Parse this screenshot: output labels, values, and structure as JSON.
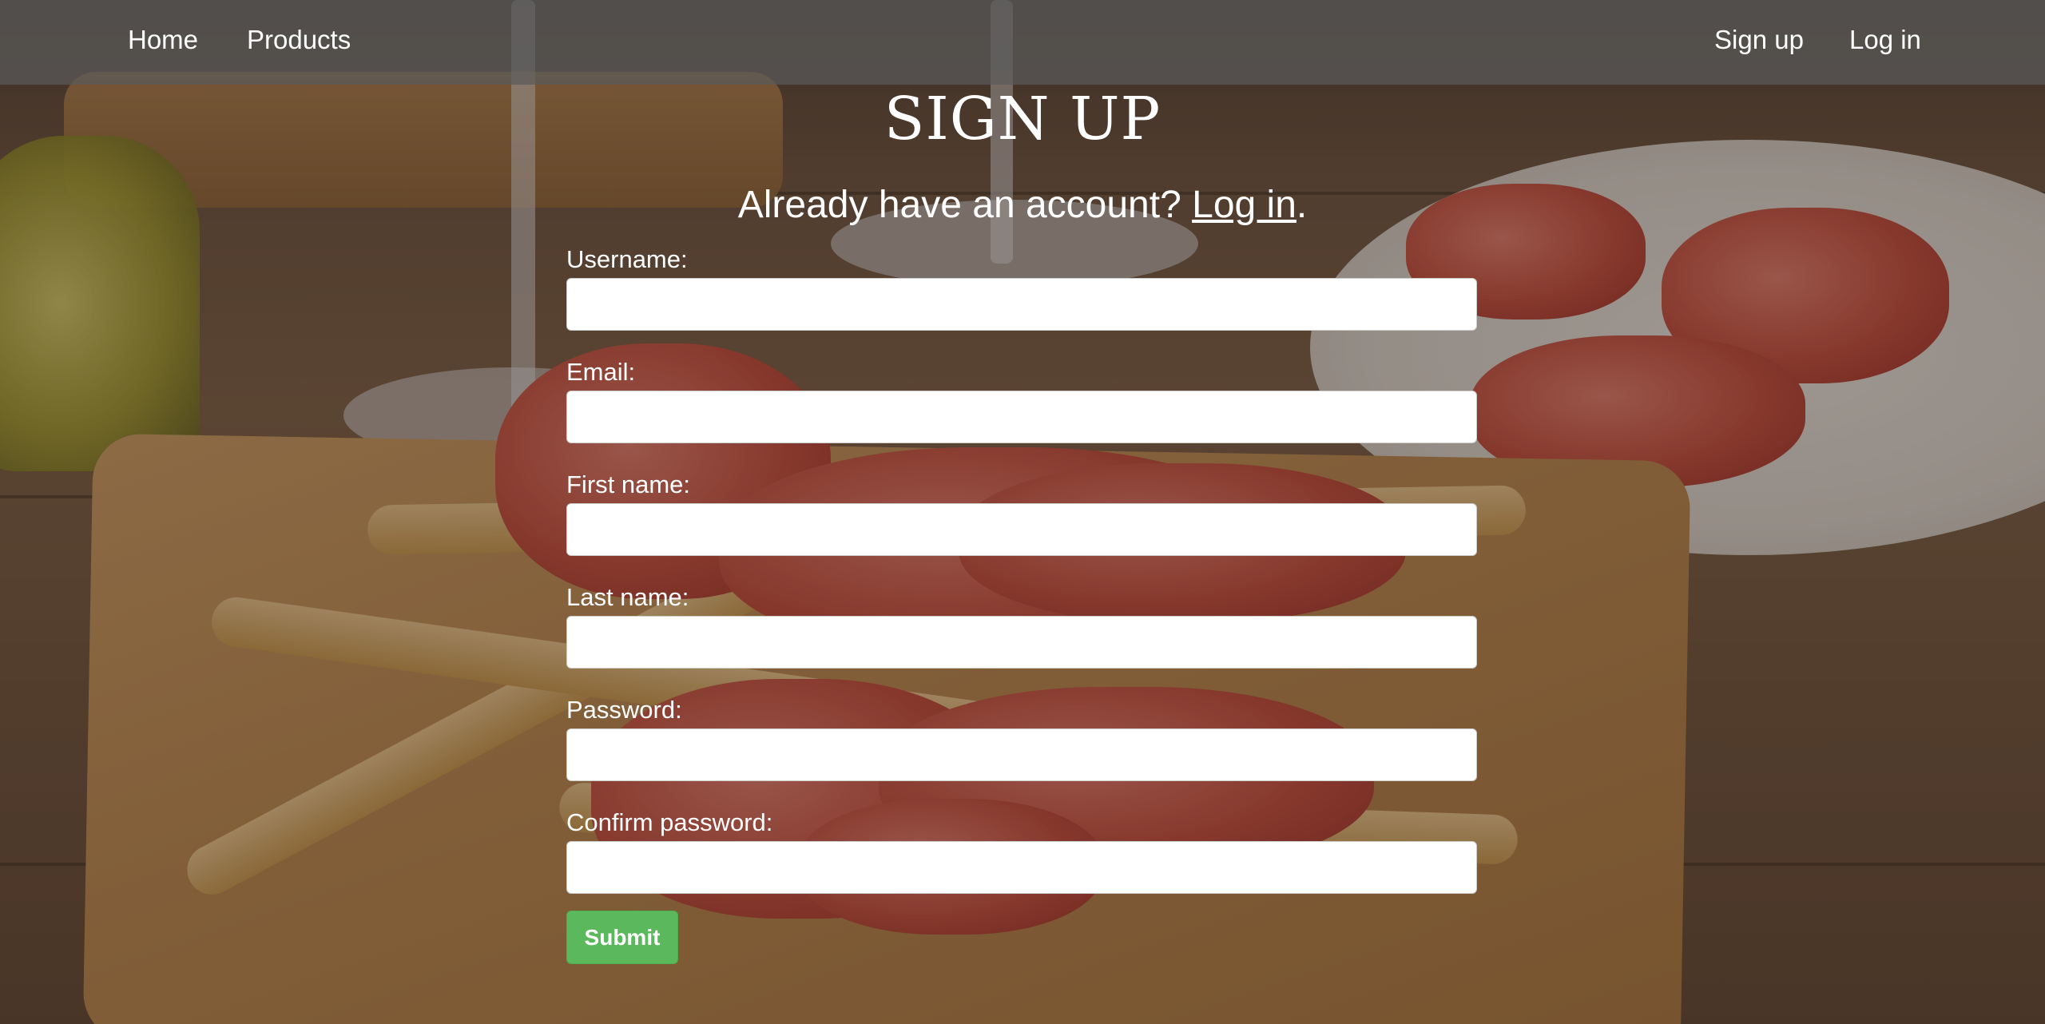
{
  "nav": {
    "home": "Home",
    "products": "Products",
    "signup": "Sign up",
    "login": "Log in"
  },
  "page": {
    "title": "SIGN UP",
    "subtitle_prefix": "Already have an account? ",
    "subtitle_link": "Log in",
    "subtitle_suffix": "."
  },
  "form": {
    "username_label": "Username:",
    "email_label": "Email:",
    "first_name_label": "First name:",
    "last_name_label": "Last name:",
    "password_label": "Password:",
    "confirm_password_label": "Confirm password:",
    "username_value": "",
    "email_value": "",
    "first_name_value": "",
    "last_name_value": "",
    "password_value": "",
    "confirm_password_value": "",
    "submit_label": "Submit"
  },
  "colors": {
    "navbar_bg": "#5a5a5a",
    "submit_bg": "#5cb85c",
    "text": "#ffffff"
  }
}
